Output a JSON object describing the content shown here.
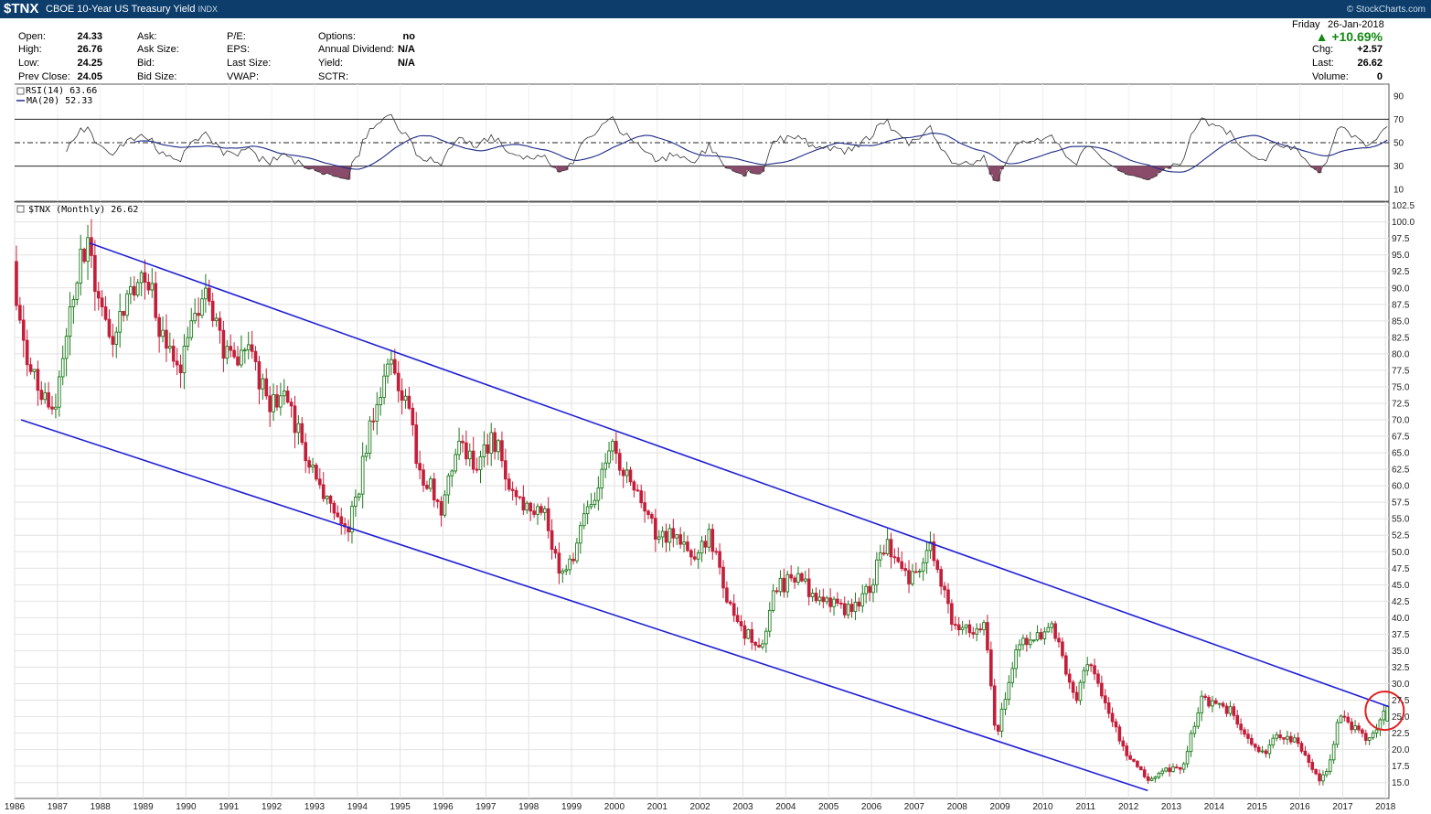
{
  "header": {
    "symbol": "$TNX",
    "name": "CBOE 10-Year US Treasury Yield",
    "exchange": "INDX",
    "brand": "© StockCharts.com",
    "date_day": "Friday",
    "date": "26-Jan-2018",
    "pct_change": "▲ +10.69%",
    "change_color": "#118811"
  },
  "quote_fields": {
    "col1": [
      {
        "label": "Open:",
        "value": "24.33"
      },
      {
        "label": "High:",
        "value": "26.76"
      },
      {
        "label": "Low:",
        "value": "24.25"
      },
      {
        "label": "Prev Close:",
        "value": "24.05"
      }
    ],
    "col2": [
      {
        "label": "Ask:",
        "value": ""
      },
      {
        "label": "Ask Size:",
        "value": ""
      },
      {
        "label": "Bid:",
        "value": ""
      },
      {
        "label": "Bid Size:",
        "value": ""
      }
    ],
    "col3": [
      {
        "label": "P/E:",
        "value": ""
      },
      {
        "label": "EPS:",
        "value": ""
      },
      {
        "label": "Last Size:",
        "value": ""
      },
      {
        "label": "VWAP:",
        "value": ""
      }
    ],
    "col4": [
      {
        "label": "Options:",
        "value": "no"
      },
      {
        "label": "Annual Dividend:",
        "value": "N/A"
      },
      {
        "label": "Yield:",
        "value": "N/A"
      },
      {
        "label": "SCTR:",
        "value": ""
      }
    ],
    "right": [
      {
        "label": "Chg:",
        "value": "+2.57"
      },
      {
        "label": "Last:",
        "value": "26.62"
      },
      {
        "label": "Volume:",
        "value": "0"
      }
    ]
  },
  "chart_data": [
    {
      "type": "line",
      "panel": "RSI",
      "legend": [
        "RSI(14) 63.66",
        "MA(20) 52.33"
      ],
      "y_ticks": [
        10,
        30,
        50,
        70,
        90
      ],
      "ylim": [
        0,
        100
      ],
      "reference_lines": [
        30,
        50,
        70
      ],
      "rsi_last": 63.66,
      "ma_last": 52.33,
      "colors": {
        "rsi": "#333333",
        "ma": "#1f2a88",
        "oversold_fill": "#8a4a6a"
      }
    },
    {
      "type": "candlestick",
      "panel": "price",
      "legend": "$TNX (Monthly) 26.62",
      "last": 26.62,
      "xlim": [
        1986.0,
        2018.08
      ],
      "ylim": [
        12.6,
        103.0
      ],
      "x_ticks": [
        "1986",
        "1987",
        "1988",
        "1989",
        "1990",
        "1991",
        "1992",
        "1993",
        "1994",
        "1995",
        "1996",
        "1997",
        "1998",
        "1999",
        "2000",
        "2001",
        "2002",
        "2003",
        "2004",
        "2005",
        "2006",
        "2007",
        "2008",
        "2009",
        "2010",
        "2011",
        "2012",
        "2013",
        "2014",
        "2015",
        "2016",
        "2017",
        "2018"
      ],
      "y_ticks": [
        15.0,
        17.5,
        20.0,
        22.5,
        25.0,
        27.5,
        30.0,
        32.5,
        35.0,
        37.5,
        40.0,
        42.5,
        45.0,
        47.5,
        50.0,
        52.5,
        55.0,
        57.5,
        60.0,
        62.5,
        65.0,
        67.5,
        70.0,
        72.5,
        75.0,
        77.5,
        80.0,
        82.5,
        85.0,
        87.5,
        90.0,
        92.5,
        95.0,
        97.5,
        100.0,
        102.5
      ],
      "anchors": [
        [
          1986.0,
          94.0
        ],
        [
          1986.25,
          80.0
        ],
        [
          1986.7,
          73.0
        ],
        [
          1987.0,
          72.0
        ],
        [
          1987.35,
          88.0
        ],
        [
          1987.75,
          97.5
        ],
        [
          1988.0,
          88.0
        ],
        [
          1988.3,
          82.0
        ],
        [
          1988.7,
          90.0
        ],
        [
          1989.1,
          92.0
        ],
        [
          1989.5,
          83.0
        ],
        [
          1989.9,
          78.0
        ],
        [
          1990.35,
          88.0
        ],
        [
          1990.65,
          87.5
        ],
        [
          1990.95,
          80.0
        ],
        [
          1991.5,
          80.0
        ],
        [
          1992.0,
          72.0
        ],
        [
          1992.4,
          75.0
        ],
        [
          1992.8,
          64.0
        ],
        [
          1993.2,
          60.0
        ],
        [
          1993.75,
          53.0
        ],
        [
          1994.0,
          57.0
        ],
        [
          1994.4,
          71.0
        ],
        [
          1994.85,
          79.0
        ],
        [
          1995.2,
          72.0
        ],
        [
          1995.5,
          62.5
        ],
        [
          1996.0,
          57.0
        ],
        [
          1996.4,
          67.0
        ],
        [
          1996.9,
          63.0
        ],
        [
          1997.2,
          68.0
        ],
        [
          1997.6,
          60.0
        ],
        [
          1998.0,
          56.0
        ],
        [
          1998.45,
          55.5
        ],
        [
          1998.75,
          46.0
        ],
        [
          1999.0,
          48.0
        ],
        [
          1999.5,
          58.0
        ],
        [
          2000.0,
          66.0
        ],
        [
          2000.5,
          60.0
        ],
        [
          2001.0,
          53.0
        ],
        [
          2001.5,
          52.0
        ],
        [
          2001.9,
          48.0
        ],
        [
          2002.25,
          53.0
        ],
        [
          2002.8,
          40.0
        ],
        [
          2003.45,
          35.0
        ],
        [
          2003.75,
          44.0
        ],
        [
          2004.4,
          47.0
        ],
        [
          2004.75,
          42.0
        ],
        [
          2005.1,
          42.0
        ],
        [
          2005.6,
          41.0
        ],
        [
          2006.0,
          45.0
        ],
        [
          2006.4,
          51.0
        ],
        [
          2006.9,
          46.0
        ],
        [
          2007.45,
          50.5
        ],
        [
          2007.9,
          40.0
        ],
        [
          2008.3,
          38.0
        ],
        [
          2008.7,
          38.5
        ],
        [
          2008.95,
          22.0
        ],
        [
          2009.45,
          36.0
        ],
        [
          2009.9,
          37.0
        ],
        [
          2010.25,
          39.0
        ],
        [
          2010.8,
          27.0
        ],
        [
          2011.1,
          34.0
        ],
        [
          2011.6,
          25.0
        ],
        [
          2012.0,
          19.5
        ],
        [
          2012.5,
          15.5
        ],
        [
          2012.9,
          17.0
        ],
        [
          2013.3,
          17.0
        ],
        [
          2013.75,
          28.0
        ],
        [
          2014.0,
          27.0
        ],
        [
          2014.4,
          26.0
        ],
        [
          2014.95,
          20.0
        ],
        [
          2015.25,
          19.0
        ],
        [
          2015.5,
          22.5
        ],
        [
          2015.95,
          21.5
        ],
        [
          2016.5,
          15.0
        ],
        [
          2016.7,
          17.0
        ],
        [
          2016.95,
          25.0
        ],
        [
          2017.35,
          23.0
        ],
        [
          2017.7,
          21.5
        ],
        [
          2018.05,
          26.62
        ]
      ],
      "annotations": {
        "channel_upper": [
          [
            1987.75,
            96.8
          ],
          [
            2018.08,
            26.5
          ]
        ],
        "channel_lower": [
          [
            1986.15,
            70.0
          ],
          [
            2012.45,
            13.8
          ]
        ],
        "circle_center": [
          2017.98,
          25.9
        ]
      },
      "colors": {
        "up": "#1d7a1d",
        "down": "#c41e3a",
        "channel": "#1f1fd6",
        "circle": "#e02020"
      }
    }
  ]
}
